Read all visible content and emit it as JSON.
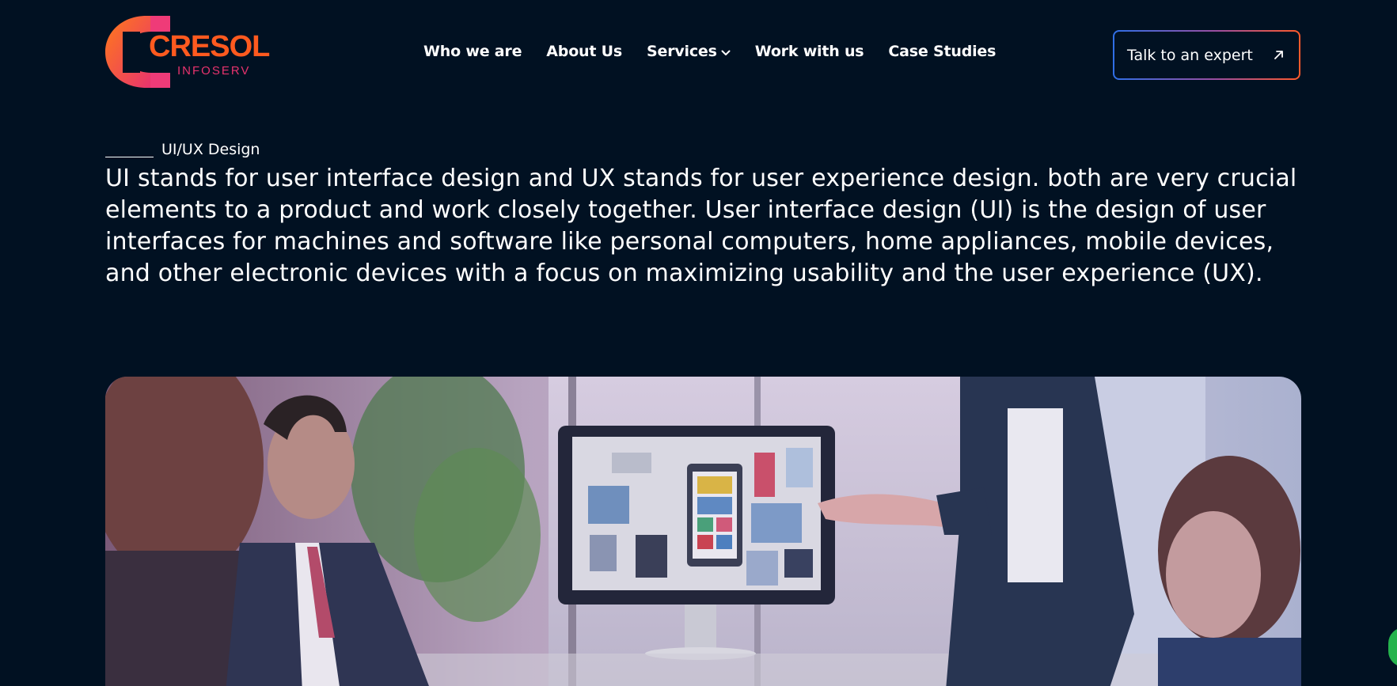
{
  "brand": {
    "name": "CRESOL",
    "sub": "INFOSERV"
  },
  "nav": {
    "items": [
      {
        "label": "Who we are"
      },
      {
        "label": "About Us"
      },
      {
        "label": "Services"
      },
      {
        "label": "Work with us"
      },
      {
        "label": "Case Studies"
      }
    ]
  },
  "cta": {
    "label": "Talk to an expert"
  },
  "section": {
    "eyebrow": "UI/UX Design",
    "description": "UI stands for user interface design and UX stands for user experience design. both are very crucial elements to a product and work closely together. User interface design (UI) is the design of user interfaces for machines and software like personal computers, home appliances, mobile devices, and other electronic devices with a focus on maximizing usability and the user experience (UX)."
  },
  "colors": {
    "background": "#011122",
    "brand_orange": "#ff5a1f",
    "brand_pink": "#e8336e",
    "chat_green": "#25b34d"
  },
  "icons": {
    "services_dropdown": "chevron-down-icon",
    "cta": "arrow-up-right-icon",
    "chat": "chat-icon"
  }
}
